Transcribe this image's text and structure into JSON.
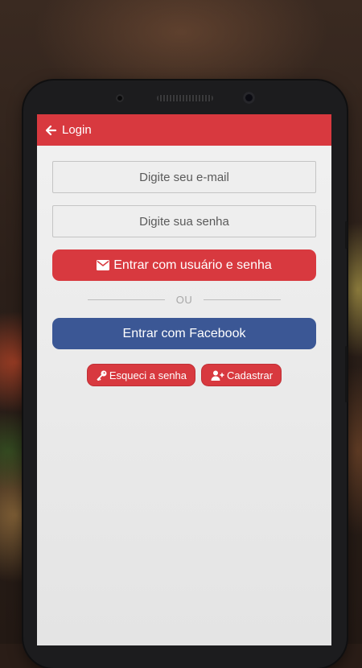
{
  "appbar": {
    "title": "Login"
  },
  "form": {
    "email_placeholder": "Digite seu e-mail",
    "password_placeholder": "Digite sua senha",
    "login_button": "Entrar com usuário e senha",
    "divider": "OU",
    "facebook_button": "Entrar com Facebook",
    "forgot_button": "Esqueci a senha",
    "register_button": "Cadastrar"
  },
  "icons": {
    "back": "arrow-left-icon",
    "login": "envelope-icon",
    "forgot": "key-icon",
    "register": "user-plus-icon"
  },
  "colors": {
    "primary": "#d8393f",
    "facebook": "#3b5795",
    "screen_bg": "#ececec"
  }
}
